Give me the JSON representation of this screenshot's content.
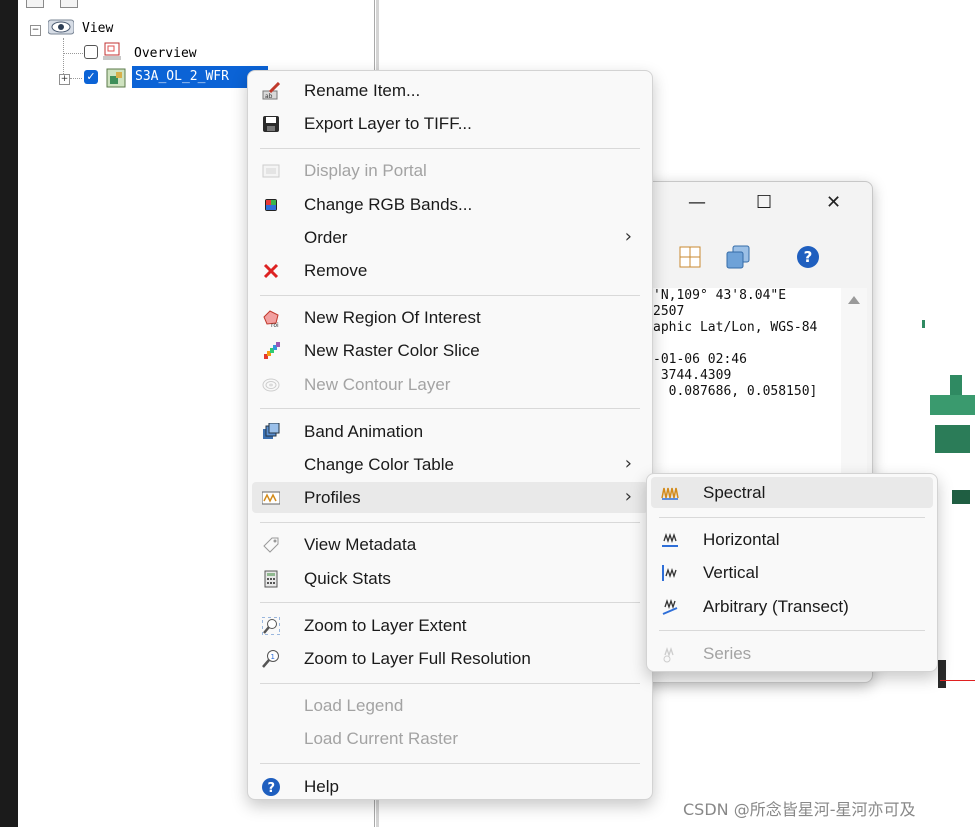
{
  "tree": {
    "root_label": "View",
    "overview_label": "Overview",
    "layer_label": "S3A_OL_2_WFR",
    "layer_checked": true,
    "overview_checked": false
  },
  "dialog": {
    "minimize": "—",
    "maximize": "☐",
    "close": "✕",
    "text_lines": [
      "'N,109° 43'8.04\"E",
      "2507",
      "aphic Lat/Lon, WGS-84",
      "",
      "-01-06 02:46",
      " 3744.4309",
      "  0.087686, 0.058150]"
    ]
  },
  "context_menu": {
    "groups": [
      [
        {
          "label": "Rename Item...",
          "icon": "rename-icon",
          "enabled": true
        },
        {
          "label": "Export Layer to TIFF...",
          "icon": "save-disk-icon",
          "enabled": true
        }
      ],
      [
        {
          "label": "Display in Portal",
          "icon": "portal-icon",
          "enabled": false
        },
        {
          "label": "Change RGB Bands...",
          "icon": "rgb-bands-icon",
          "enabled": true
        },
        {
          "label": "Order",
          "icon": "",
          "enabled": true,
          "submenu": true
        },
        {
          "label": "Remove",
          "icon": "remove-x-icon",
          "enabled": true
        }
      ],
      [
        {
          "label": "New Region Of Interest",
          "icon": "roi-icon",
          "enabled": true
        },
        {
          "label": "New Raster Color Slice",
          "icon": "color-slice-icon",
          "enabled": true
        },
        {
          "label": "New Contour Layer",
          "icon": "contour-icon",
          "enabled": false
        }
      ],
      [
        {
          "label": "Band Animation",
          "icon": "band-animation-icon",
          "enabled": true
        },
        {
          "label": "Change Color Table",
          "icon": "",
          "enabled": true,
          "submenu": true
        },
        {
          "label": "Profiles",
          "icon": "profiles-icon",
          "enabled": true,
          "submenu": true,
          "highlighted": true
        }
      ],
      [
        {
          "label": "View Metadata",
          "icon": "metadata-tag-icon",
          "enabled": true
        },
        {
          "label": "Quick Stats",
          "icon": "calculator-icon",
          "enabled": true
        }
      ],
      [
        {
          "label": "Zoom to Layer Extent",
          "icon": "zoom-extent-icon",
          "enabled": true
        },
        {
          "label": "Zoom to Layer Full Resolution",
          "icon": "zoom-full-res-icon",
          "enabled": true
        }
      ],
      [
        {
          "label": "Load Legend",
          "icon": "",
          "enabled": false
        },
        {
          "label": "Load Current Raster",
          "icon": "",
          "enabled": false
        }
      ],
      [
        {
          "label": "Help",
          "icon": "help-icon",
          "enabled": true
        }
      ]
    ]
  },
  "submenu": {
    "groups": [
      [
        {
          "label": "Spectral",
          "icon": "spectral-icon",
          "enabled": true,
          "highlighted": true
        }
      ],
      [
        {
          "label": "Horizontal",
          "icon": "horizontal-profile-icon",
          "enabled": true
        },
        {
          "label": "Vertical",
          "icon": "vertical-profile-icon",
          "enabled": true
        },
        {
          "label": "Arbitrary (Transect)",
          "icon": "transect-icon",
          "enabled": true
        }
      ],
      [
        {
          "label": "Series",
          "icon": "series-icon",
          "enabled": false
        }
      ]
    ]
  },
  "watermark": "CSDN @所念皆星河-星河亦可及",
  "colors": {
    "selection": "#0b63d6",
    "menu_bg": "#f9f9f9",
    "highlight": "#e9e9e9",
    "disabled": "#a3a3a3",
    "map_green": "#2f8a62"
  }
}
